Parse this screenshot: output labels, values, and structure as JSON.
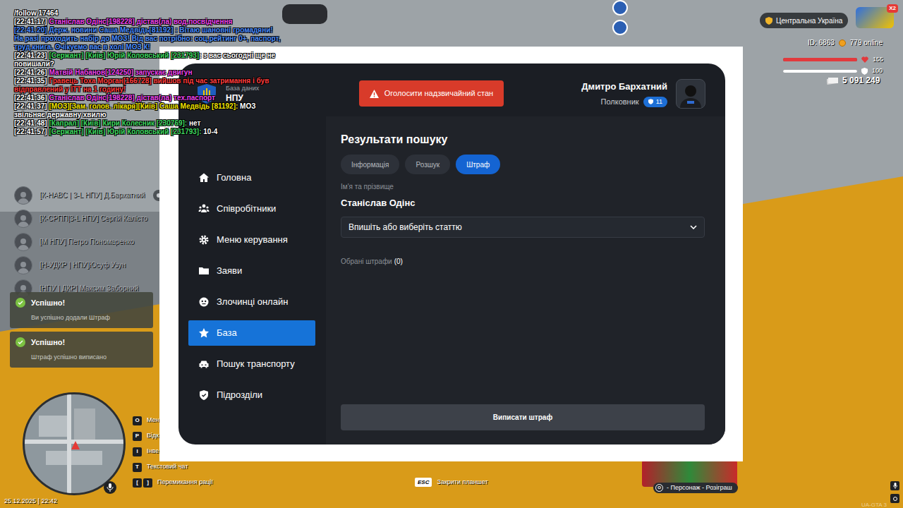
{
  "chat": [
    {
      "segments": [
        {
          "text": "/follow 17464",
          "color": "#ffffff"
        }
      ]
    },
    {
      "segments": [
        {
          "text": "[22:41:17] ",
          "color": "#ffffff"
        },
        {
          "text": "Станіслав Одінс[198228] дістав(ла) вод.посвідчення",
          "color": "#ee45ee"
        }
      ]
    },
    {
      "segments": [
        {
          "text": "[22:41:20] Держ. новини Саша Медвідь[81192] :  Вітаю шановні громадяни! На разі проходить набір до МОЗ! Від вас потрібно: соц.рейтинг 0+, паспорт, труд.книга. Очікуємо вас в холі МОЗ К!",
          "color": "#4a8dff"
        }
      ]
    },
    {
      "segments": [
        {
          "text": "[22:41:23] ",
          "color": "#ffffff"
        },
        {
          "text": "[Сержант] [Київ] Юрій Коловський [231793]",
          "color": "#3fd760"
        },
        {
          "text": ": з вас сьогодні ще не повишали?",
          "color": "#ffffff"
        }
      ]
    },
    {
      "segments": [
        {
          "text": "[22:41:26] ",
          "color": "#ffffff"
        },
        {
          "text": "Матвій Набанов[124250] запускає двигун",
          "color": "#ee45ee"
        }
      ]
    },
    {
      "segments": [
        {
          "text": "[22:41:35] ",
          "color": "#ffffff"
        },
        {
          "text": "Гравець Тоха Морган[166728] вийшов під час затримання і був відправлений у ІТТ на 1 годину!",
          "color": "#ff3d3d"
        }
      ]
    },
    {
      "segments": [
        {
          "text": "[22:41:36] ",
          "color": "#ffffff"
        },
        {
          "text": "Станіслав Одінс[198228] дістав(ла) тех.паспорт",
          "color": "#ee45ee"
        }
      ]
    },
    {
      "segments": [
        {
          "text": "[22:41:37] ",
          "color": "#ffffff"
        },
        {
          "text": "[МОЗ][Зам. голов. лікаря][Київ] Саша Медвідь [81192]:",
          "color": "#f2e400"
        },
        {
          "text": " МОЗ звільняє державну хвилю",
          "color": "#ffffff"
        }
      ]
    },
    {
      "segments": [
        {
          "text": "[22:41:48] ",
          "color": "#ffffff"
        },
        {
          "text": "[Капрал] [Київ]  Кири Колесник [230769]:",
          "color": "#3fd760"
        },
        {
          "text": " нет",
          "color": "#ffffff"
        }
      ]
    },
    {
      "segments": [
        {
          "text": "[22:41:57] ",
          "color": "#ffffff"
        },
        {
          "text": "[Сержант] [Київ]  Юрій Коловський [231793]:",
          "color": "#3fd760"
        },
        {
          "text": " 10-4",
          "color": "#ffffff"
        }
      ]
    }
  ],
  "voice_chat": [
    {
      "name": "[К-НАВС | 3-L НПУ] Д.Бархатний",
      "badge": "UGTA"
    },
    {
      "name": "[К-СРПП|3-L НПУ] Сергій Калісто"
    },
    {
      "name": "[М НПУ] Петро Пономаренко"
    },
    {
      "name": "[Н-УДКР | НПУ]Юсуф Узун"
    },
    {
      "name": "[НПУ | ДКР] Максим Заборний"
    }
  ],
  "notifications": [
    {
      "title": "Успішно!",
      "message": "Ви успішно додали Штраф"
    },
    {
      "title": "Успішно!",
      "message": "Штраф успішно виписано"
    }
  ],
  "keybinds": [
    {
      "keys": [
        "O"
      ],
      "label": "Мен"
    },
    {
      "keys": [
        "P"
      ],
      "label": "Відк"
    },
    {
      "keys": [
        "I"
      ],
      "label": "Інве"
    },
    {
      "keys": [
        "T"
      ],
      "label": "Текстовий чат"
    },
    {
      "keys": [
        "[",
        "]"
      ],
      "label": "Перемикання рації"
    }
  ],
  "datetime": "25.12.2025 | 22:42",
  "hud": {
    "server": "Центральна Україна",
    "logo_badge": "X2",
    "id": "ID: 6863",
    "online": "779 online",
    "health": {
      "value": "155",
      "level": 1
    },
    "armor": {
      "value": "100",
      "level": 1
    },
    "money": "5 091 249"
  },
  "close_hint": {
    "key": "ESC",
    "label": "Закрити планшет"
  },
  "giveaway": {
    "key": "O",
    "label": "- Персонаж - Розіграш"
  },
  "watermark": "UA-GTA 3",
  "tablet": {
    "header": {
      "subtitle": "База даних",
      "title": "НПУ"
    },
    "emergency_button": "Оголосити надзвичайний стан",
    "user": {
      "name": "Дмитро Бархатний",
      "rank": "Полковник",
      "level": "11"
    },
    "sidebar": [
      {
        "label": "Головна",
        "selected": false
      },
      {
        "label": "Співробітники",
        "selected": false
      },
      {
        "label": "Меню керування",
        "selected": false
      },
      {
        "label": "Заяви",
        "selected": false
      },
      {
        "label": "Злочинці онлайн",
        "selected": false
      },
      {
        "label": "База",
        "selected": true
      },
      {
        "label": "Пошук транспорту",
        "selected": false
      },
      {
        "label": "Підрозділи",
        "selected": false
      }
    ],
    "results": {
      "title": "Результати пошуку",
      "tabs": [
        {
          "label": "Інформація",
          "selected": false
        },
        {
          "label": "Розшук",
          "selected": false
        },
        {
          "label": "Штраф",
          "selected": true
        }
      ],
      "name_label": "Ім'я та прізвище",
      "name": "Станіслав Одінс",
      "article_placeholder": "Впишіть або виберіть статтю",
      "selected_fines_label": "Обрані штрафи",
      "selected_fines_count": "(0)",
      "submit": "Виписати штраф"
    }
  }
}
